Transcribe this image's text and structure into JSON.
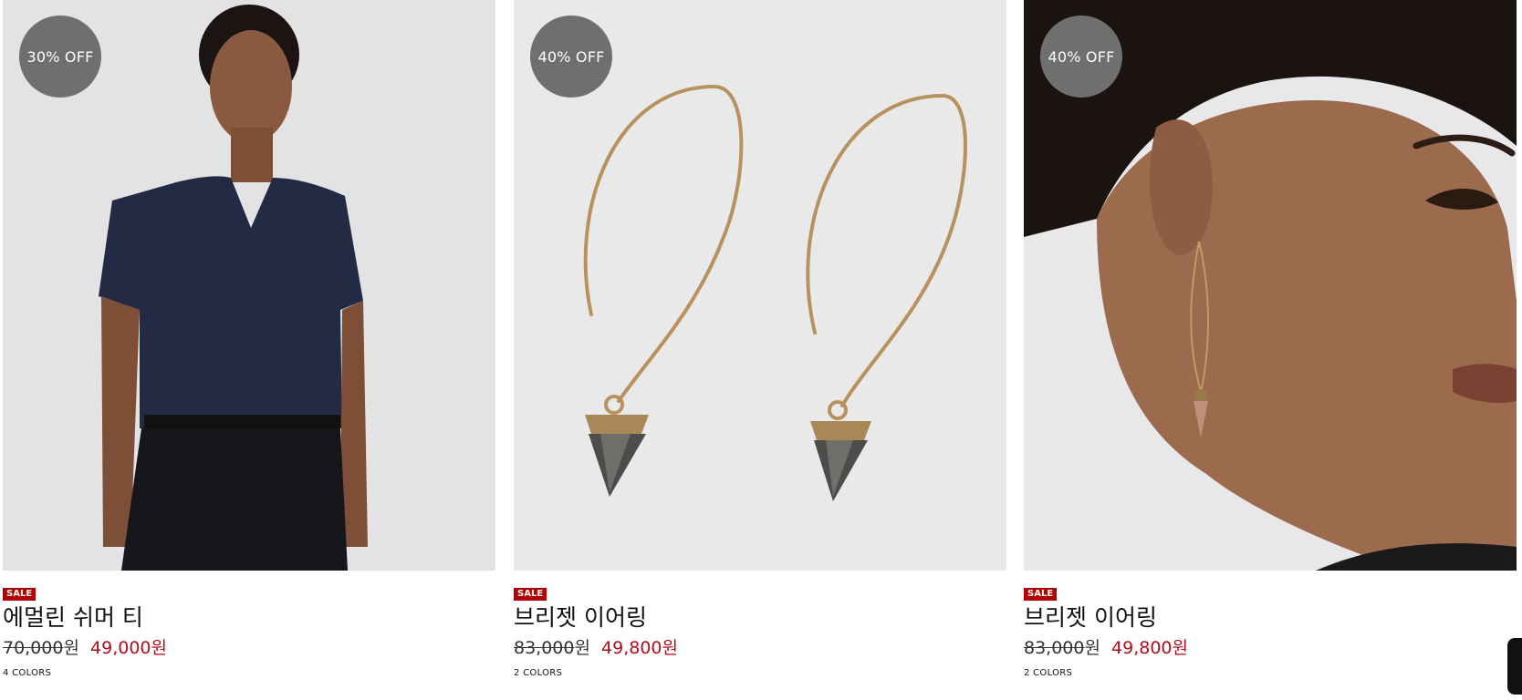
{
  "products": [
    {
      "badge": "30% OFF",
      "sale_label": "SALE",
      "name": "에멀린 쉬머 티",
      "original_price": "70,000",
      "original_currency": "원",
      "sale_price": "49,000원",
      "colors": "4 COLORS"
    },
    {
      "badge": "40% OFF",
      "sale_label": "SALE",
      "name": "브리젯 이어링",
      "original_price": "83,000",
      "original_currency": "원",
      "sale_price": "49,800원",
      "colors": "2 COLORS"
    },
    {
      "badge": "40% OFF",
      "sale_label": "SALE",
      "name": "브리젯 이어링",
      "original_price": "83,000",
      "original_currency": "원",
      "sale_price": "49,800원",
      "colors": "2 COLORS"
    }
  ],
  "colors": {
    "badge_bg": "#6f6f6f",
    "sale_tag_bg": "#b30000",
    "sale_price": "#b30e1d"
  }
}
